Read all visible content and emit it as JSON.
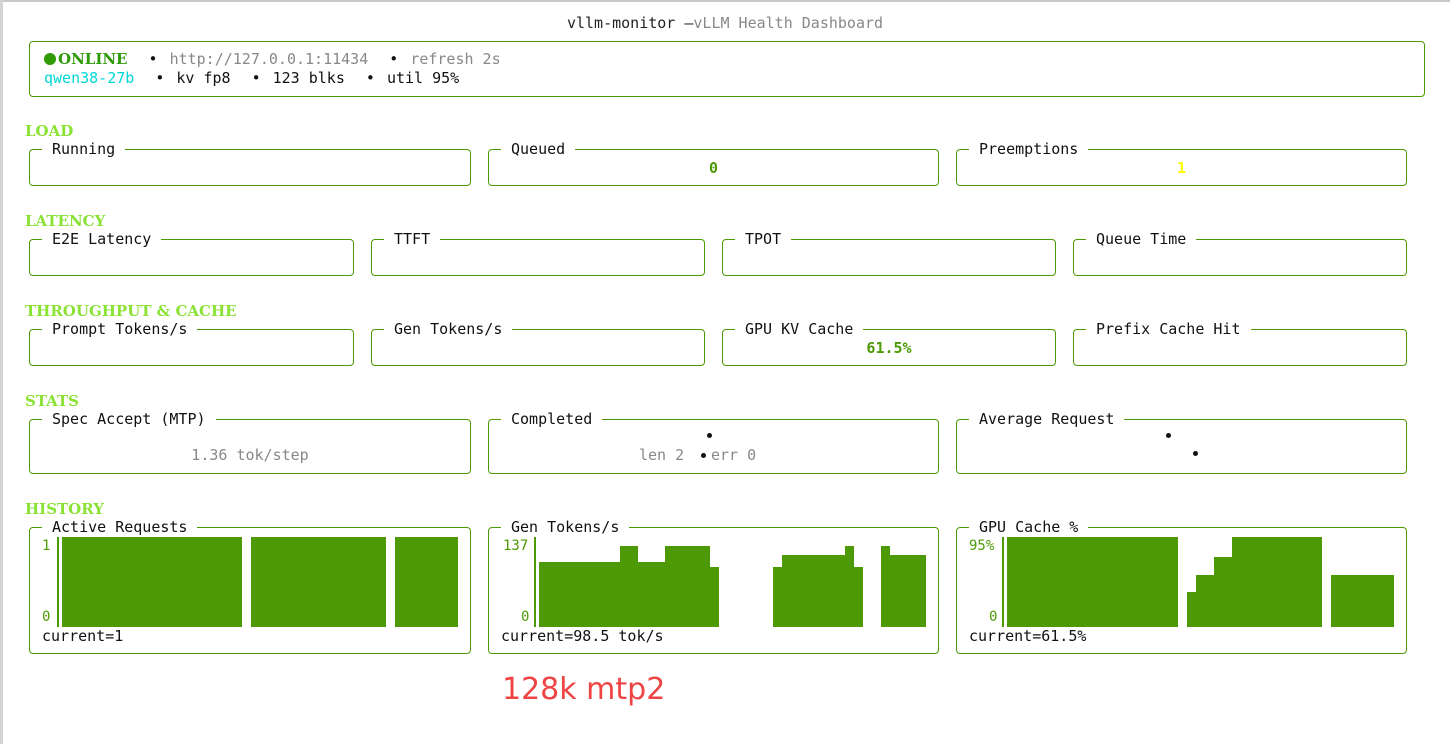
{
  "header": {
    "title_main": "vllm-monitor —",
    "title_sub": "vLLM Health Dashboard"
  },
  "status": {
    "online": "ONLINE",
    "url": "http://127.0.0.1:11434",
    "refresh": "refresh 2s",
    "model": "qwen38-27b",
    "kv": "kv fp8",
    "blocks": "123 blks",
    "util": "util 95%",
    "separator": "•"
  },
  "sections": {
    "load": "LOAD",
    "latency": "LATENCY",
    "throughput": "THROUGHPUT & CACHE",
    "stats": "STATS",
    "history": "HISTORY"
  },
  "load": {
    "running": {
      "label": "Running",
      "value": ""
    },
    "queued": {
      "label": "Queued",
      "value": "0"
    },
    "preemptions": {
      "label": "Preemptions",
      "value": "1"
    }
  },
  "latency": {
    "e2e": {
      "label": "E2E Latency"
    },
    "ttft": {
      "label": "TTFT"
    },
    "tpot": {
      "label": "TPOT"
    },
    "queue_time": {
      "label": "Queue Time"
    }
  },
  "throughput": {
    "prompt": {
      "label": "Prompt Tokens/s"
    },
    "gen": {
      "label": "Gen Tokens/s"
    },
    "gpu_kv": {
      "label": "GPU KV Cache",
      "value": "61.5%"
    },
    "prefix": {
      "label": "Prefix Cache Hit"
    }
  },
  "stats": {
    "spec": {
      "label": "Spec Accept (MTP)",
      "value": "1.36 tok/step"
    },
    "completed": {
      "label": "Completed",
      "len": "len 2",
      "err": "err 0"
    },
    "avg_request": {
      "label": "Average Request"
    }
  },
  "history": {
    "active": {
      "label": "Active Requests",
      "y_max": "1",
      "y_min": "0",
      "current": "current=1",
      "max": 1,
      "bars": [
        [
          0,
          20,
          1
        ],
        [
          21,
          36,
          1
        ],
        [
          37,
          44,
          1
        ]
      ]
    },
    "gen_tokens": {
      "label": "Gen Tokens/s",
      "y_max": "137",
      "y_min": "0",
      "current": "current=98.5 tok/s",
      "max": 137,
      "bars": [
        [
          0,
          9,
          99
        ],
        [
          9,
          11,
          124
        ],
        [
          11,
          14,
          99
        ],
        [
          14,
          19,
          124
        ],
        [
          19,
          20,
          92
        ],
        [
          26,
          27,
          92
        ],
        [
          27,
          34,
          110
        ],
        [
          34,
          35,
          124
        ],
        [
          35,
          36,
          92
        ],
        [
          38,
          39,
          124
        ],
        [
          39,
          43,
          110
        ]
      ]
    },
    "gpu_cache": {
      "label": "GPU Cache %",
      "y_max": "95%",
      "y_min": "0",
      "current": "current=61.5%",
      "max": 95,
      "bars": [
        [
          0,
          19,
          95
        ],
        [
          20,
          21,
          37
        ],
        [
          21,
          23,
          55
        ],
        [
          23,
          25,
          74
        ],
        [
          25,
          35,
          95
        ],
        [
          36,
          43,
          55
        ]
      ]
    }
  },
  "annotation": "128k mtp2",
  "colors": {
    "border": "#4e9a06",
    "section": "#8ae234",
    "online": "#2e9a06",
    "model": "#00d7d7",
    "preemptions": "#ffff00",
    "bars": "#4e9a06",
    "note": "#ee4444"
  }
}
